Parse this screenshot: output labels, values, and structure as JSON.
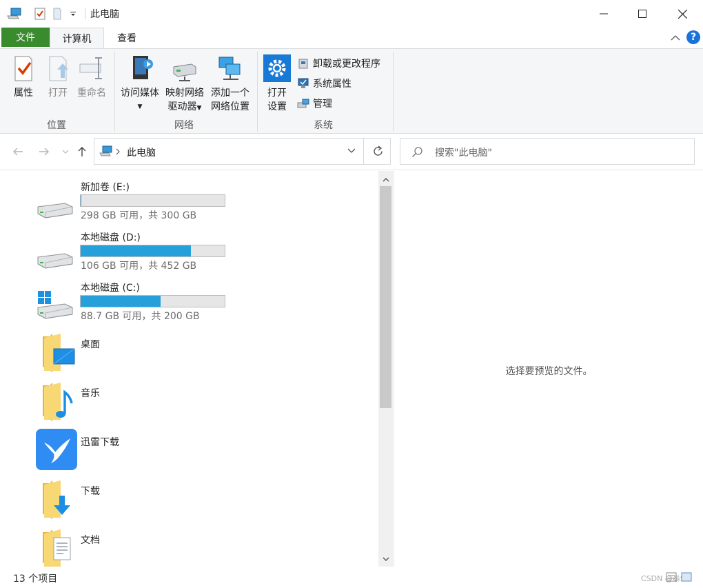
{
  "window": {
    "title": "此电脑",
    "watermark": "CSDN @泰S..."
  },
  "ribbon": {
    "tabs": {
      "file": "文件",
      "computer": "计算机",
      "view": "查看"
    },
    "groups": {
      "location": {
        "label": "位置",
        "properties": "属性",
        "open": "打开",
        "rename": "重命名"
      },
      "network": {
        "label": "网络",
        "access_media": "访问媒体",
        "map_drive_1": "映射网络",
        "map_drive_2": "驱动器",
        "add_location_1": "添加一个",
        "add_location_2": "网络位置"
      },
      "system": {
        "label": "系统",
        "open_settings_1": "打开",
        "open_settings_2": "设置",
        "uninstall": "卸载或更改程序",
        "system_properties": "系统属性",
        "manage": "管理"
      }
    }
  },
  "address": {
    "path": "此电脑",
    "search_placeholder": "搜索\"此电脑\""
  },
  "drives": [
    {
      "name": "新加卷 (E:)",
      "usage": "298 GB 可用，共 300 GB",
      "used_fraction": 0.0067
    },
    {
      "name": "本地磁盘 (D:)",
      "usage": "106 GB 可用，共 452 GB",
      "used_fraction": 0.765
    },
    {
      "name": "本地磁盘 (C:)",
      "usage": "88.7 GB 可用，共 200 GB",
      "used_fraction": 0.557
    }
  ],
  "folders": [
    {
      "name": "桌面"
    },
    {
      "name": "音乐"
    },
    {
      "name": "迅雷下载"
    },
    {
      "name": "下载"
    },
    {
      "name": "文档"
    }
  ],
  "preview": {
    "message": "选择要预览的文件。"
  },
  "status": {
    "count": "13 个项目"
  },
  "colors": {
    "file_tab": "#3a8a2e",
    "bar_fill": "#26a0da",
    "accent_blue": "#1a73d9"
  }
}
